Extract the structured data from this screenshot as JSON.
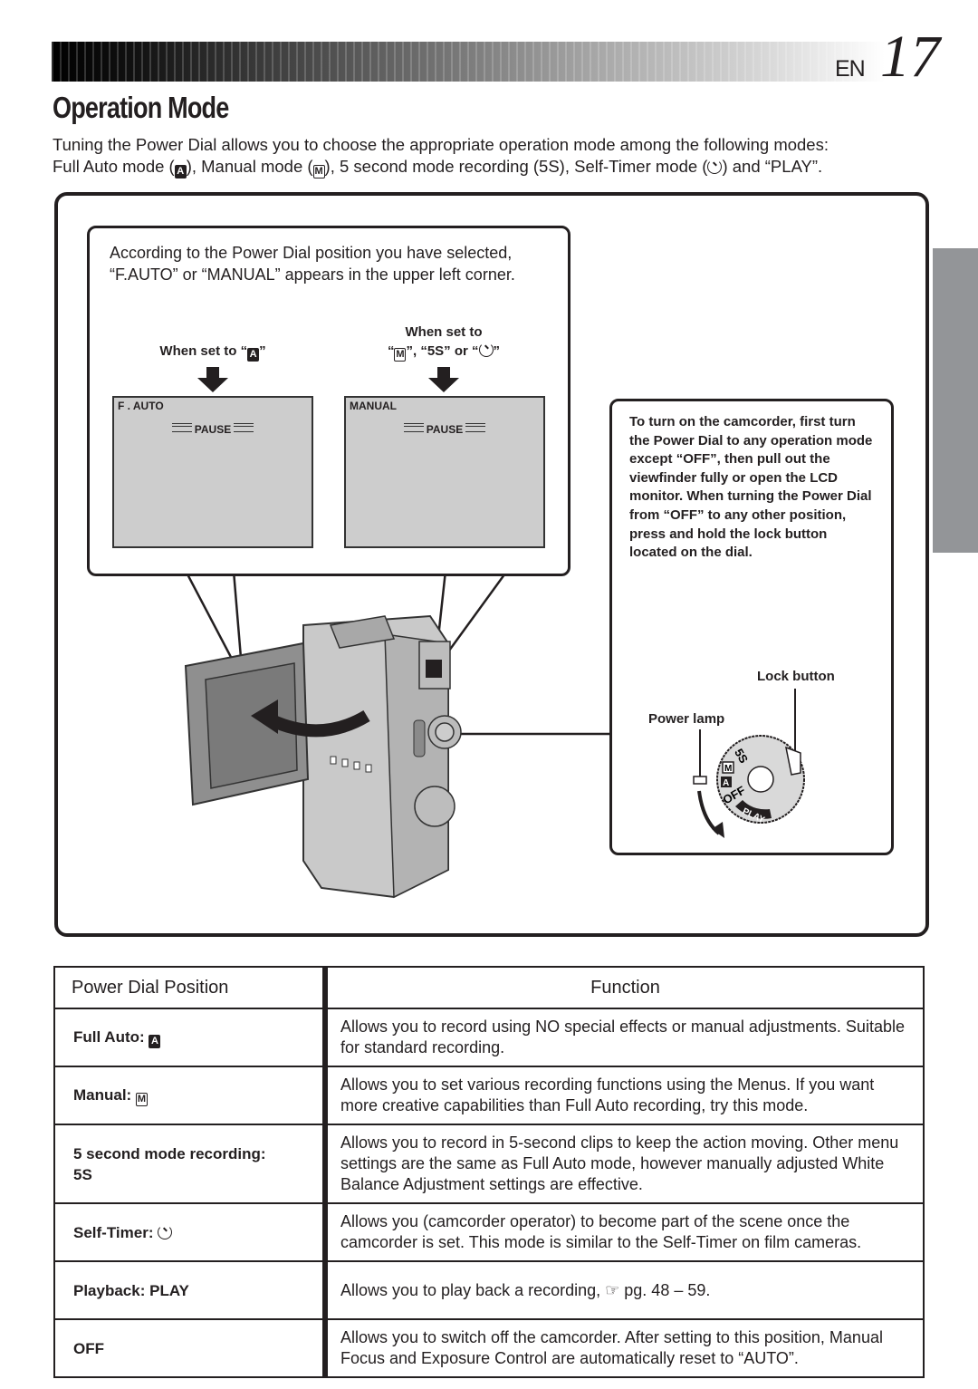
{
  "header": {
    "language": "EN",
    "page_number": "17"
  },
  "title": "Operation Mode",
  "intro": {
    "line1": "Tuning the Power Dial allows you to choose the appropriate operation mode among the following modes:",
    "line2_a": "Full Auto mode (",
    "line2_b": "), Manual mode (",
    "line2_c": "), 5 second mode recording (5S), Self-Timer mode (",
    "line2_d": ") and “PLAY”.",
    "glyph_auto": "A",
    "glyph_manual": "M"
  },
  "diagram": {
    "callout_top_text": "According to the Power Dial position you have selected, “F.AUTO” or “MANUAL” appears in the upper left corner.",
    "when_auto": {
      "prefix": "When set to “",
      "glyph": "A",
      "suffix": "”"
    },
    "when_manual": {
      "line1": "When set to",
      "prefix": "“",
      "glyph": "M",
      "middle": "”, “5S” or “",
      "suffix": "”"
    },
    "screen_auto": {
      "mode": "F . AUTO",
      "status": "PAUSE"
    },
    "screen_manual": {
      "mode": "MANUAL",
      "status": "PAUSE"
    },
    "callout_right_text": "To turn on the camcorder, first turn the Power Dial to any operation mode except “OFF”, then pull out the viewfinder fully or open the LCD monitor. When turning the Power Dial from “OFF” to any other position, press and hold the lock button located on the dial.",
    "lock_button_label": "Lock button",
    "power_lamp_label": "Power lamp",
    "dial_labels": [
      "5S",
      "M",
      "A",
      "OFF",
      "PLAY"
    ]
  },
  "table": {
    "headers": {
      "position": "Power Dial Position",
      "function": "Function"
    },
    "rows": [
      {
        "position": "Full Auto:",
        "glyph": "A",
        "function": "Allows you to record using NO special effects or manual adjustments. Suitable for standard recording."
      },
      {
        "position": "Manual:",
        "glyph": "M",
        "function": "Allows you to set various recording functions using the Menus. If you want more creative capabilities than Full Auto recording, try this mode."
      },
      {
        "position": "5 second mode recording: 5S",
        "function": "Allows you to record in 5-second clips to keep the action moving. Other menu settings are the same as Full Auto mode, however manually adjusted White Balance Adjustment settings are effective."
      },
      {
        "position": "Self-Timer:",
        "glyph": "timer",
        "function": "Allows you (camcorder operator) to become part of the scene once the camcorder is set. This mode is similar to the Self-Timer on film cameras."
      },
      {
        "position": "Playback: PLAY",
        "function": "Allows you to play back a recording, ☞ pg. 48 – 59."
      },
      {
        "position": "OFF",
        "function": "Allows you to switch off the camcorder. After setting to this position, Manual Focus and Exposure Control are automatically reset to “AUTO”."
      }
    ]
  }
}
